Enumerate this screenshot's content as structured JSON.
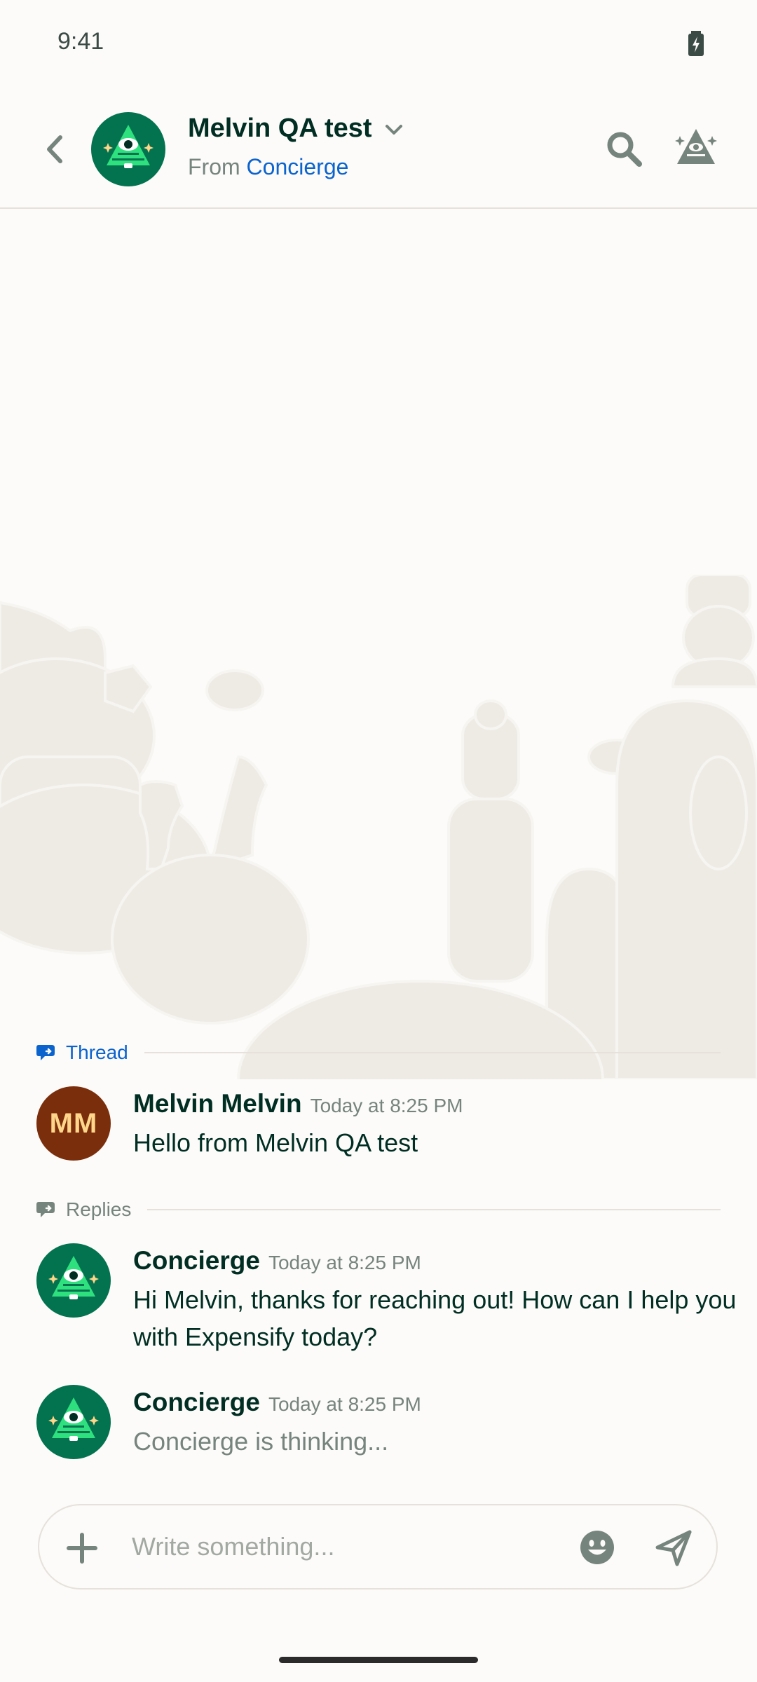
{
  "status_bar": {
    "time": "9:41"
  },
  "header": {
    "title": "Melvin QA test",
    "subtitle_prefix": "From ",
    "subtitle_link": "Concierge"
  },
  "thread": {
    "label": "Thread",
    "message": {
      "avatar_initials": "MM",
      "author": "Melvin Melvin",
      "time": "Today at 8:25 PM",
      "text": "Hello from Melvin QA test"
    }
  },
  "replies": {
    "label": "Replies",
    "messages": [
      {
        "author": "Concierge",
        "time": "Today at 8:25 PM",
        "text": "Hi Melvin, thanks for reaching out! How can I help you with Expensify today?"
      },
      {
        "author": "Concierge",
        "time": "Today at 8:25 PM",
        "text": "Concierge is thinking..."
      }
    ]
  },
  "composer": {
    "placeholder": "Write something..."
  },
  "colors": {
    "background": "#FCFBF9",
    "text": "#002E22",
    "muted": "#76847E",
    "link": "#0B63CE",
    "concierge_green": "#03734F",
    "avatar_brown": "#7A2E0B"
  },
  "icons": [
    "battery-icon",
    "back-icon",
    "chevron-down-icon",
    "search-icon",
    "concierge-icon",
    "thread-icon",
    "replies-icon",
    "plus-icon",
    "emoji-icon",
    "send-icon"
  ]
}
